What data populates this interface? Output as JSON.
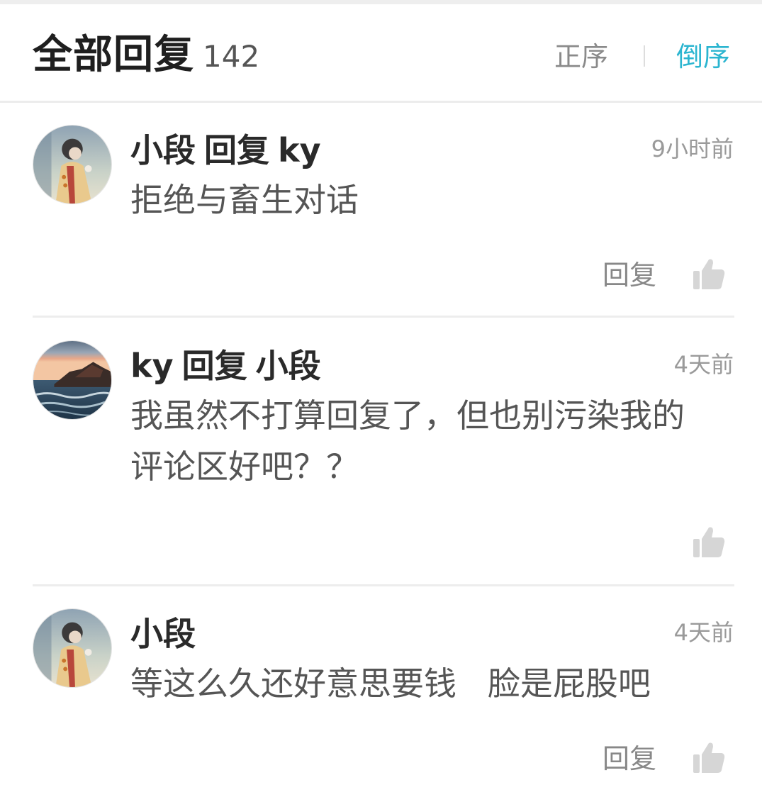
{
  "header": {
    "title": "全部回复",
    "count": "142",
    "sort_asc_label": "正序",
    "sort_desc_label": "倒序",
    "active_sort": "倒序",
    "accent_color": "#2bb5d0"
  },
  "comments": [
    {
      "author": "小段",
      "reply_word": "回复",
      "reply_to": "ky",
      "time": "9小时前",
      "content": "拒绝与畜生对话",
      "reply_label": "回复",
      "avatar_icon": "avatar-illustrated-figure",
      "like_icon": "thumbs-up-icon"
    },
    {
      "author": "ky",
      "reply_word": "回复",
      "reply_to": "小段",
      "time": "4天前",
      "content": "我虽然不打算回复了，但也别污染我的评论区好吧？？",
      "avatar_icon": "avatar-seascape-sunset",
      "like_icon": "thumbs-up-icon"
    },
    {
      "author": "小段",
      "time": "4天前",
      "content": "等这么久还好意思要钱   脸是屁股吧",
      "reply_label": "回复",
      "avatar_icon": "avatar-illustrated-figure",
      "like_icon": "thumbs-up-icon"
    }
  ]
}
